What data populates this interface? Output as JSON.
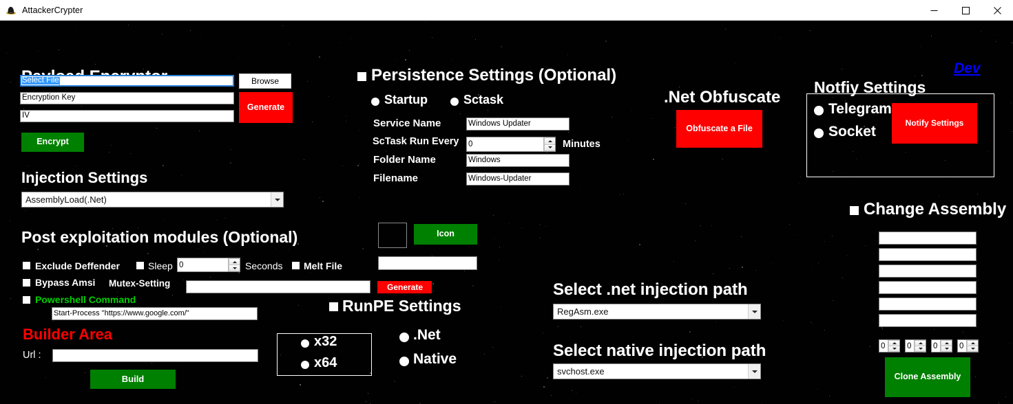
{
  "window": {
    "title": "AttackerCrypter",
    "icon": "black-hat-icon",
    "minimize_label": "Minimize",
    "maximize_label": "Maximize",
    "close_label": "Close"
  },
  "dev_link": {
    "label": "Dev"
  },
  "payload_encryptor": {
    "heading": "Payload Encryptor",
    "select_file_value": "Select File",
    "encryption_key_value": "Encryption Key",
    "iv_value": "IV",
    "browse_label": "Browse",
    "generate_label": "Generate",
    "encrypt_label": "Encrypt"
  },
  "injection_settings": {
    "heading": "Injection Settings",
    "selected": "AssemblyLoad(.Net)",
    "options": [
      "AssemblyLoad(.Net)"
    ]
  },
  "post_exploitation": {
    "heading": "Post exploitation modules (Optional)",
    "exclude_defender_label": "Exclude Deffender",
    "sleep_label": "Sleep",
    "sleep_value": "0",
    "seconds_label": "Seconds",
    "melt_file_label": "Melt File",
    "bypass_amsi_label": "Bypass Amsi",
    "mutex_setting_label": "Mutex-Setting",
    "mutex_value": "",
    "mutex_generate_label": "Generate",
    "powershell_command_label": "Powershell Command",
    "powershell_value": "Start-Process \"https://www.google.com/\""
  },
  "builder_area": {
    "heading": "Builder Area",
    "url_label": "Url :",
    "url_value": "",
    "build_label": "Build"
  },
  "persistence": {
    "heading": "Persistence Settings (Optional)",
    "startup_label": "Startup",
    "sctask_label": "Sctask",
    "service_name_label": "Service Name",
    "service_name_value": "Windows Updater",
    "sctask_run_every_label": "ScTask Run Every",
    "sctask_run_every_value": "0",
    "minutes_label": "Minutes",
    "folder_name_label": "Folder Name",
    "folder_name_value": "Windows",
    "filename_label": "Filename",
    "filename_value": "Windows-Updater"
  },
  "icon_section": {
    "icon_button_label": "Icon",
    "icon_path_value": "",
    "generate_label": "Generate"
  },
  "runpe": {
    "heading": "RunPE Settings",
    "x32_label": "x32",
    "x64_label": "x64",
    "net_label": ".Net",
    "native_label": "Native"
  },
  "net_obfuscate": {
    "heading": ".Net Obfuscate",
    "button_label": "Obfuscate a File"
  },
  "notify": {
    "heading": "Notfiy Settings",
    "telegram_label": "Telegram",
    "socket_label": "Socket",
    "button_label": "Notify Settings"
  },
  "injection_paths": {
    "net_heading": "Select .net injection path",
    "net_selected": "RegAsm.exe",
    "native_heading": "Select native injection path",
    "native_selected": "svchost.exe"
  },
  "change_assembly": {
    "heading": "Change Assembly",
    "fields": [
      "",
      "",
      "",
      "",
      "",
      ""
    ],
    "version_parts": [
      "0",
      "0",
      "0",
      "0"
    ],
    "clone_label": "Clone Assembly"
  },
  "colors": {
    "background": "#010101",
    "accent_red": "#ff0000",
    "accent_green": "#008000",
    "text": "#ffffff",
    "link": "#0000ff",
    "builder_heading": "#ff0000",
    "powershell_label": "#00d000"
  }
}
